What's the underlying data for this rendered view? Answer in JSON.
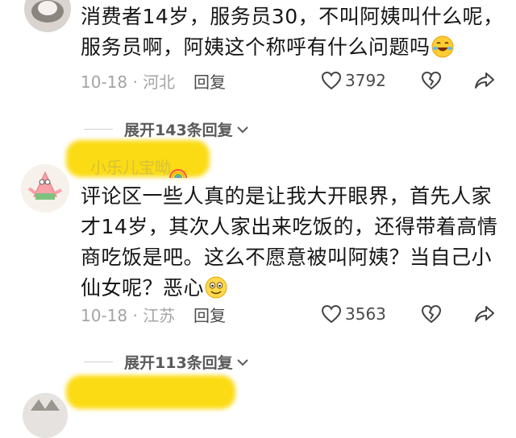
{
  "comments": [
    {
      "text_line1": "消费者14岁，服务员30，不叫阿姨叫什么呢，",
      "text_line2": "服务员啊，阿姨这个称呼有什么问题吗",
      "emoji": "rolling-laughing-emoji",
      "date_location": "10-18 · 河北",
      "reply_label": "回复",
      "likes": "3792",
      "expand_label": "展开143条回复"
    },
    {
      "username": "小乐儿宝呦",
      "text_line1": "评论区一些人真的是让我大开眼界，首先人家",
      "text_line2": "才14岁，其次人家出来吃饭的，还得带着高情",
      "text_line3": "商吃饭是吧。这么不愿意被叫阿姨？当自己小",
      "text_line4": "仙女呢？恶心",
      "emoji": "smiling-emoji",
      "date_location": "10-18 · 江苏",
      "reply_label": "回复",
      "likes": "3563",
      "expand_label": "展开113条回复"
    }
  ],
  "colors": {
    "text": "#161616",
    "meta": "#a4a4a4",
    "redaction": "#fbd800"
  }
}
